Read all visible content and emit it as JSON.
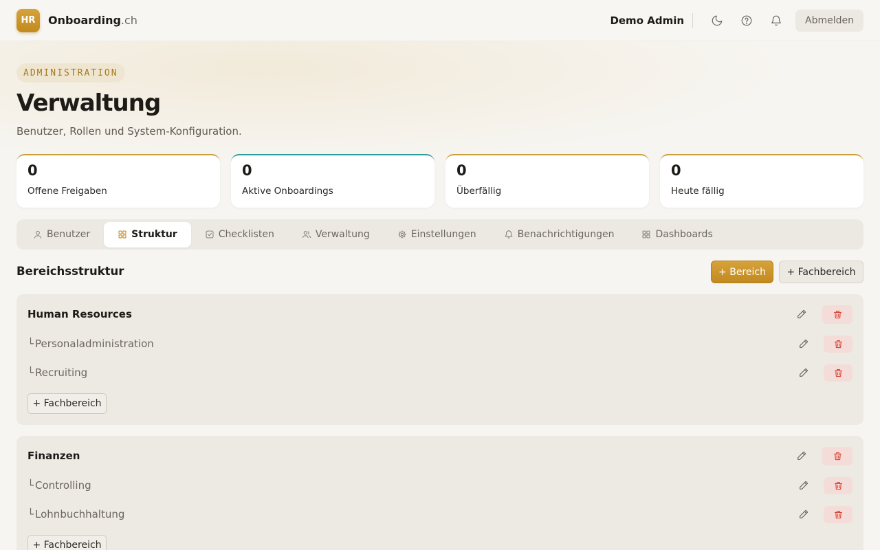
{
  "header": {
    "logo_text": "HR",
    "brand_name": "Onboarding",
    "brand_tld": ".ch",
    "user_name": "Demo Admin",
    "logout_label": "Abmelden",
    "icons": [
      "moon-icon",
      "help-circle-icon",
      "bell-icon"
    ]
  },
  "hero": {
    "pill": "ADMINISTRATION",
    "title": "Verwaltung",
    "subtitle": "Benutzer, Rollen und System-Konfiguration."
  },
  "stats": [
    {
      "value": "0",
      "label": "Offene Freigaben",
      "accent": "#c9a13a"
    },
    {
      "value": "0",
      "label": "Aktive Onboardings",
      "accent": "#2e9d9a"
    },
    {
      "value": "0",
      "label": "Überfällig",
      "accent": "#c9a13a"
    },
    {
      "value": "0",
      "label": "Heute fällig",
      "accent": "#c9a13a"
    }
  ],
  "tabs": [
    {
      "label": "Benutzer",
      "icon": "user-icon"
    },
    {
      "label": "Struktur",
      "icon": "grid-icon",
      "active": true
    },
    {
      "label": "Checklisten",
      "icon": "checkbox-icon"
    },
    {
      "label": "Verwaltung",
      "icon": "users-icon"
    },
    {
      "label": "Einstellungen",
      "icon": "gear-icon"
    },
    {
      "label": "Benachrichtigungen",
      "icon": "bell-icon"
    },
    {
      "label": "Dashboards",
      "icon": "dashboard-icon"
    }
  ],
  "section": {
    "title": "Bereichsstruktur",
    "add_area_label": "+ Bereich",
    "add_sub_label": "+ Fachbereich"
  },
  "areas": [
    {
      "name": "Human Resources",
      "subareas": [
        "Personaladministration",
        "Recruiting"
      ],
      "add_label": "+ Fachbereich"
    },
    {
      "name": "Finanzen",
      "subareas": [
        "Controlling",
        "Lohnbuchhaltung"
      ],
      "add_label": "+ Fachbereich"
    }
  ],
  "colors": {
    "accent_gold": "#c9a13a",
    "accent_teal": "#2e9d9a",
    "danger": "#d9453a"
  }
}
